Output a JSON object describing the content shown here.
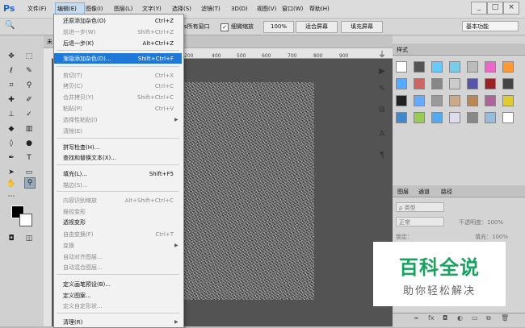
{
  "app": {
    "logo": "Ps"
  },
  "menubar": {
    "items": [
      "文件(F)",
      "编辑(E)",
      "图像(I)",
      "图层(L)",
      "文字(Y)",
      "选择(S)",
      "滤镜(T)",
      "3D(D)",
      "视图(V)",
      "窗口(W)",
      "帮助(H)"
    ],
    "active": "编辑(E)"
  },
  "window_controls": {
    "minimize": "_",
    "maximize": "□",
    "close": "×"
  },
  "options_bar": {
    "tool_preset": "🔍",
    "partial_label": "窗口",
    "all_windows_label": "ꜱ所有窗口",
    "scrubby_zoom_label": "细微缩放",
    "zoom_100": "100%",
    "fit_screen": "适合屏幕",
    "fill_screen": "填充屏幕",
    "workspace": "基本功能"
  },
  "document": {
    "tab_partial": "未"
  },
  "ruler": {
    "ticks": [
      "200",
      "300",
      "400",
      "500",
      "600",
      "700",
      "800",
      "900"
    ]
  },
  "edit_menu": {
    "items": [
      {
        "label": "还原添加杂色(O)",
        "shortcut": "Ctrl+Z",
        "enabled": true
      },
      {
        "label": "前进一步(W)",
        "shortcut": "Shift+Ctrl+Z",
        "enabled": false
      },
      {
        "label": "后退一步(K)",
        "shortcut": "Alt+Ctrl+Z",
        "enabled": true
      },
      {
        "label": "渐隐添加杂色(D)...",
        "shortcut": "Shift+Ctrl+F",
        "enabled": true,
        "highlighted": true
      },
      {
        "label": "剪切(T)",
        "shortcut": "Ctrl+X",
        "enabled": false
      },
      {
        "label": "拷贝(C)",
        "shortcut": "Ctrl+C",
        "enabled": false
      },
      {
        "label": "合并拷贝(Y)",
        "shortcut": "Shift+Ctrl+C",
        "enabled": false
      },
      {
        "label": "粘贴(P)",
        "shortcut": "Ctrl+V",
        "enabled": false
      },
      {
        "label": "选择性粘贴(I)",
        "shortcut": "",
        "enabled": false,
        "submenu": true
      },
      {
        "label": "清除(E)",
        "shortcut": "",
        "enabled": false
      },
      {
        "label": "拼写检查(H)...",
        "shortcut": "",
        "enabled": true
      },
      {
        "label": "查找和替换文本(X)...",
        "shortcut": "",
        "enabled": true
      },
      {
        "label": "填充(L)...",
        "shortcut": "Shift+F5",
        "enabled": true
      },
      {
        "label": "描边(S)...",
        "shortcut": "",
        "enabled": false
      },
      {
        "label": "内容识别缩放",
        "shortcut": "Alt+Shift+Ctrl+C",
        "enabled": false
      },
      {
        "label": "操控变形",
        "shortcut": "",
        "enabled": false
      },
      {
        "label": "透视变形",
        "shortcut": "",
        "enabled": true
      },
      {
        "label": "自由变换(F)",
        "shortcut": "Ctrl+T",
        "enabled": false
      },
      {
        "label": "变换",
        "shortcut": "",
        "enabled": false,
        "submenu": true
      },
      {
        "label": "自动对齐图层...",
        "shortcut": "",
        "enabled": false
      },
      {
        "label": "自动混合图层...",
        "shortcut": "",
        "enabled": false
      },
      {
        "label": "定义画笔预设(B)...",
        "shortcut": "",
        "enabled": true
      },
      {
        "label": "定义图案...",
        "shortcut": "",
        "enabled": true
      },
      {
        "label": "定义自定形状...",
        "shortcut": "",
        "enabled": false
      },
      {
        "label": "清理(R)",
        "shortcut": "",
        "enabled": true,
        "submenu": true
      }
    ]
  },
  "swatches_panel": {
    "title": "样式"
  },
  "layers_panel": {
    "tabs": [
      "图层",
      "通道",
      "路径"
    ],
    "kind_label": "ρ 类型",
    "blend_mode": "正常",
    "opacity_label": "不透明度：100%",
    "lock_label": "锁定：",
    "fill_label": "填充：100%"
  },
  "watermark": {
    "big": "百科全说",
    "small": "助你轻松解决"
  },
  "colors": {
    "highlight": "#1e78d8",
    "watermark_green": "#19a15f"
  }
}
